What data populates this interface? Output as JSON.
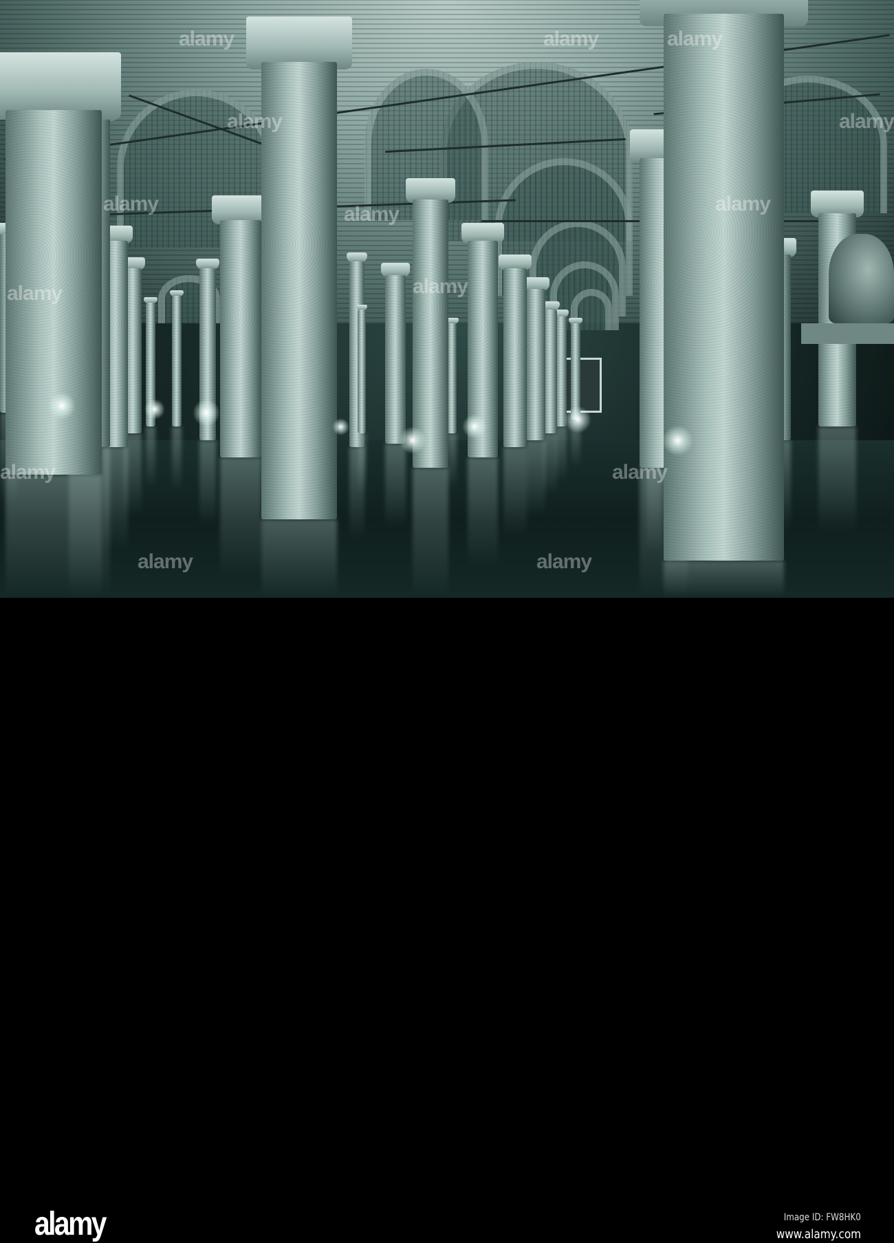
{
  "photo": {
    "subject": "Underground cistern hall with columns reflected in water",
    "tint": "#2f4a47"
  },
  "watermark": {
    "text": "alamy"
  },
  "footer": {
    "logo": "alamy",
    "image_id": "Image ID: FW8HK0",
    "url": "www.alamy.com"
  }
}
